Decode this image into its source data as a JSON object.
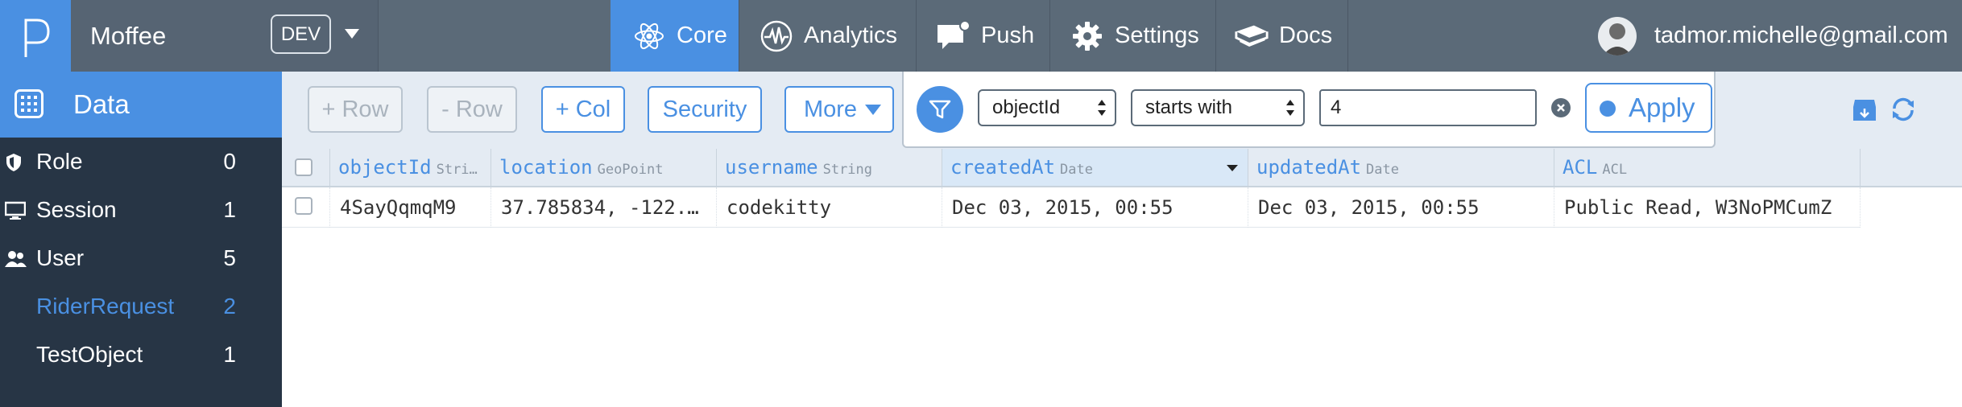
{
  "app": {
    "name": "Moffee",
    "env": "DEV"
  },
  "nav": {
    "tabs": [
      {
        "label": "Core",
        "icon": "atom-icon",
        "active": true
      },
      {
        "label": "Analytics",
        "icon": "pulse-icon"
      },
      {
        "label": "Push",
        "icon": "chat-icon"
      },
      {
        "label": "Settings",
        "icon": "gear-icon"
      },
      {
        "label": "Docs",
        "icon": "book-icon"
      }
    ]
  },
  "user": {
    "email": "tadmor.michelle@gmail.com"
  },
  "sidebar": {
    "section": "Data",
    "classes": [
      {
        "name": "Role",
        "count": "0",
        "icon": "shield-icon"
      },
      {
        "name": "Session",
        "count": "1",
        "icon": "monitor-icon"
      },
      {
        "name": "User",
        "count": "5",
        "icon": "users-icon"
      },
      {
        "name": "RiderRequest",
        "count": "2",
        "active": true
      },
      {
        "name": "TestObject",
        "count": "1"
      }
    ]
  },
  "toolbar": {
    "add_row": "+ Row",
    "remove_row": "- Row",
    "add_col": "+ Col",
    "security": "Security",
    "more": "More"
  },
  "filter": {
    "field": "objectId",
    "operator": "starts with",
    "value": "4",
    "apply": "Apply"
  },
  "table": {
    "columns": [
      {
        "name": "objectId",
        "type": "Stri…"
      },
      {
        "name": "location",
        "type": "GeoPoint"
      },
      {
        "name": "username",
        "type": "String"
      },
      {
        "name": "createdAt",
        "type": "Date",
        "sorted": true
      },
      {
        "name": "updatedAt",
        "type": "Date"
      },
      {
        "name": "ACL",
        "type": "ACL"
      }
    ],
    "rows": [
      [
        "4SayQqmqM9",
        "37.785834, -122.…",
        "codekitty",
        "Dec 03, 2015, 00:55",
        "Dec 03, 2015, 00:55",
        "Public Read, W3NoPMCumZ"
      ]
    ]
  },
  "colors": {
    "accent": "#4a90e2",
    "topbar": "#5b6a78",
    "sidebar": "#273545"
  }
}
